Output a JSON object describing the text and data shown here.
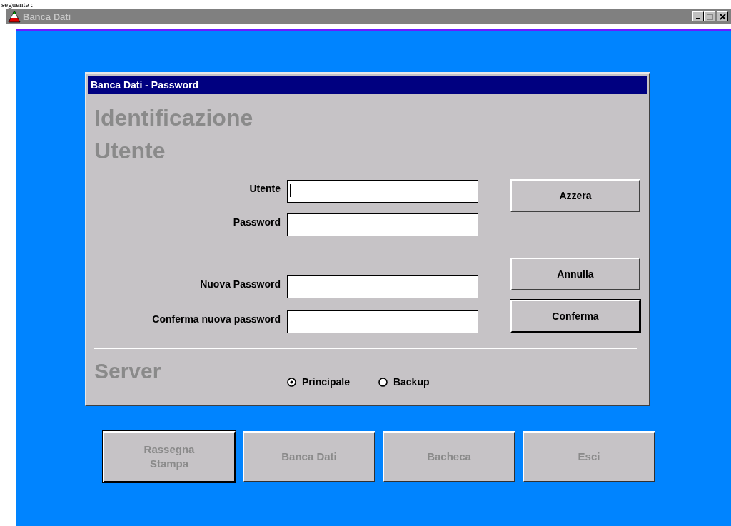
{
  "document_text": "seguente :",
  "window": {
    "title": "Banca Dati"
  },
  "dialog": {
    "title": "Banca Dati - Password",
    "heading": [
      "Identificazione",
      "Utente"
    ],
    "fields": [
      {
        "label": "Utente",
        "focused": true
      },
      {
        "label": "Password",
        "focused": false
      },
      {
        "label": "Nuova Password",
        "focused": false
      },
      {
        "label": "Conferma nuova password",
        "focused": false
      }
    ],
    "buttons": [
      {
        "label": "Azzera",
        "default": false
      },
      {
        "label": "Annulla",
        "default": false
      },
      {
        "label": "Conferma",
        "default": true
      }
    ],
    "server": {
      "label": "Server",
      "options": [
        {
          "label": "Principale",
          "selected": true
        },
        {
          "label": "Backup",
          "selected": false
        }
      ]
    }
  },
  "nav_buttons": [
    {
      "label": "Rassegna\nStampa",
      "default": true,
      "disabled": true
    },
    {
      "label": "Banca Dati",
      "default": false,
      "disabled": true
    },
    {
      "label": "Bacheca",
      "default": false,
      "disabled": true
    },
    {
      "label": "Esci",
      "default": false,
      "disabled": true
    }
  ]
}
